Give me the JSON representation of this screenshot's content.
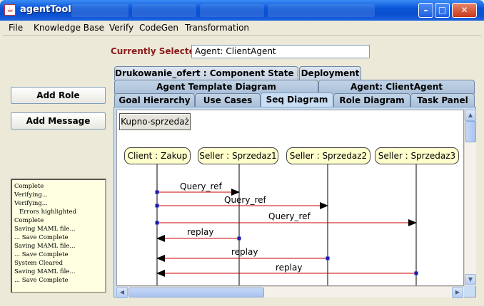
{
  "window": {
    "title": "agentTool"
  },
  "menu": [
    "File",
    "Knowledge Base",
    "Verify",
    "CodeGen",
    "Transformation"
  ],
  "left": {
    "add_role": "Add Role",
    "add_message": "Add Message",
    "log": [
      "Complete",
      "Verifying...",
      "Verifying...",
      "  Errors highlighted",
      "Complete",
      "Saving MAML file...",
      "... Save Complete",
      "Saving MAML file...",
      "... Save Complete",
      "System Cleared",
      "Saving MAML file...",
      "... Save Complete"
    ]
  },
  "selection": {
    "label": "Currently Selected",
    "value": "Agent: ClientAgent"
  },
  "tabs": {
    "row1": [
      "Drukowanie_ofert : Component State Diag",
      "Deployment"
    ],
    "row2": [
      "Agent Template Diagram",
      "Agent: ClientAgent"
    ],
    "row3": [
      "Goal Hierarchy",
      "Use Cases",
      "Seq Diagram",
      "Role Diagram",
      "Task Panel"
    ],
    "selected": "Seq Diagram"
  },
  "diagram": {
    "name": "Kupno-sprzedaż",
    "lifelines": [
      "Client : Zakup",
      "Seller : Sprzedaz1",
      "Seller : Sprzedaz2",
      "Seller : Sprzedaz3"
    ],
    "messages": [
      {
        "label": "Query_ref",
        "from": 0,
        "to": 1
      },
      {
        "label": "Query_ref",
        "from": 0,
        "to": 2
      },
      {
        "label": "Query_ref",
        "from": 0,
        "to": 3
      },
      {
        "label": "replay",
        "from": 1,
        "to": 0
      },
      {
        "label": "replay",
        "from": 2,
        "to": 0
      },
      {
        "label": "replay",
        "from": 3,
        "to": 0
      }
    ],
    "message_color": "#cc0000",
    "handle_color": "#1a1ab4"
  },
  "icons": [
    "java-cup-icon",
    "minimize-icon",
    "maximize-icon",
    "close-icon",
    "arrow-up-icon",
    "arrow-down-icon",
    "arrow-left-icon",
    "arrow-right-icon"
  ]
}
